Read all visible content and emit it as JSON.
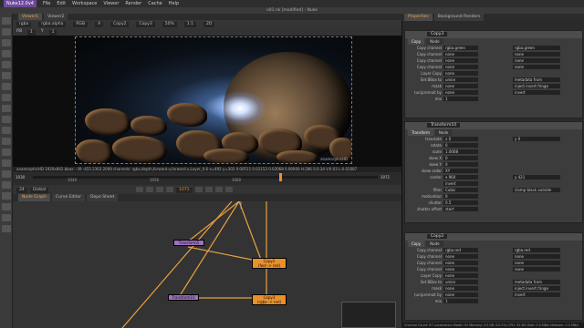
{
  "menubar": {
    "app": "Nuke12.0v4",
    "items": [
      "File",
      "Edit",
      "Workspace",
      "Viewer",
      "Render",
      "Cache",
      "Help"
    ]
  },
  "window_title": "v01.nk [modified] - Nuke",
  "viewer": {
    "tabs": [
      "Viewer1",
      "Viewer2"
    ],
    "channels": "rgba",
    "layer": "rgba.alpha",
    "colorspace": "RGB",
    "display_a": "A",
    "input_a": "Copy2",
    "input_b": "Copy3",
    "zoom": "50%",
    "ratio": "1:1",
    "mode": "2D",
    "gain_label": "f/8",
    "gain_value": "1",
    "y_label": "Y",
    "y_value": "1",
    "frame_overlay": "anamorphicHD",
    "format_info": "anamorphicHD 1920x842  bbox: -39 -455 2363 2009 channels: rgba,depth,forward.u,forward.v,Layer_0.6  x=492 y=302  0.00511  0.01153  0.02068  0.00000  H:286 S:0.34 V:0.03  L:0.01087",
    "frame_start": "1030",
    "frame_end": "1071",
    "current_frame": "1071",
    "fps": "24",
    "tl_labels": [
      "1030",
      "1040",
      "1050",
      "1060",
      "1071"
    ],
    "global": "Global"
  },
  "node_graph": {
    "tabs": [
      "Node Graph",
      "Curve Editor",
      "Dope Sheet"
    ],
    "nodes": [
      {
        "name": "Transform5",
        "type": "transform"
      },
      {
        "name": "Copy2",
        "sub": "(fwd -> red)"
      },
      {
        "name": "Transform10",
        "type": "transform"
      },
      {
        "name": "Copy3",
        "sub": "(rgba -> red)"
      }
    ]
  },
  "properties": {
    "tabs": [
      "Properties",
      "Background Renders"
    ],
    "panel1": {
      "title": "Copy3",
      "tabs": [
        "Copy",
        "Node"
      ],
      "rows": [
        {
          "label": "Copy channel",
          "a": "rgba.green",
          "b": "rgba.green"
        },
        {
          "label": "Copy channel",
          "a": "none",
          "b": "none"
        },
        {
          "label": "Copy channel",
          "a": "none",
          "b": "none"
        },
        {
          "label": "Copy channel",
          "a": "none",
          "b": "none"
        },
        {
          "label": "Layer Copy",
          "a": "none",
          "b": ""
        },
        {
          "label": "Set BBox to",
          "a": "union",
          "b": "metadata from"
        },
        {
          "label": "mask",
          "a": "none",
          "b": "inject  invert  fringe"
        },
        {
          "label": "(un)premult by",
          "a": "none",
          "b": "invert"
        },
        {
          "label": "mix",
          "a": "1",
          "b": ""
        }
      ]
    },
    "panel2": {
      "title": "Transform10",
      "tabs": [
        "Transform",
        "Node"
      ],
      "rows": [
        {
          "label": "translate",
          "a": "x  0",
          "b": "y  0"
        },
        {
          "label": "rotate",
          "a": "0",
          "b": ""
        },
        {
          "label": "scale",
          "a": "1.0008",
          "b": ""
        },
        {
          "label": "skew X",
          "a": "0",
          "b": ""
        },
        {
          "label": "skew Y",
          "a": "0",
          "b": ""
        },
        {
          "label": "skew order",
          "a": "XY",
          "b": ""
        },
        {
          "label": "center",
          "a": "x  960",
          "b": "y  421"
        },
        {
          "label": "",
          "a": "invert",
          "b": ""
        },
        {
          "label": "filter",
          "a": "Cubic",
          "b": "clamp  black outside"
        },
        {
          "label": "motionblur",
          "a": "0",
          "b": ""
        },
        {
          "label": "shutter",
          "a": "0.5",
          "b": ""
        },
        {
          "label": "shutter offset",
          "a": "start",
          "b": ""
        }
      ]
    },
    "panel3": {
      "title": "Copy2",
      "tabs": [
        "Copy",
        "Node"
      ],
      "rows": [
        {
          "label": "Copy channel",
          "a": "rgba.red",
          "b": "rgba.red"
        },
        {
          "label": "Copy channel",
          "a": "none",
          "b": "none"
        },
        {
          "label": "Copy channel",
          "a": "none",
          "b": "none"
        },
        {
          "label": "Copy channel",
          "a": "none",
          "b": "none"
        },
        {
          "label": "Layer Copy",
          "a": "none",
          "b": ""
        },
        {
          "label": "Set BBox to",
          "a": "union",
          "b": "metadata from"
        },
        {
          "label": "mask",
          "a": "none",
          "b": "inject  invert  fringe"
        },
        {
          "label": "(un)premult by",
          "a": "none",
          "b": "invert"
        },
        {
          "label": "mix",
          "a": "1",
          "b": ""
        }
      ]
    }
  },
  "status": "Channel Count: 67  Localization Mode: On  Memory: 3.5 GB (24.2%)  CPU: 32.6%  Disk: 0.0 MB/s  Network: 0.0 MB/s",
  "colors": {
    "accent": "#e89030",
    "transform_node": "#a070c0",
    "copy_node": "#e8902a"
  }
}
